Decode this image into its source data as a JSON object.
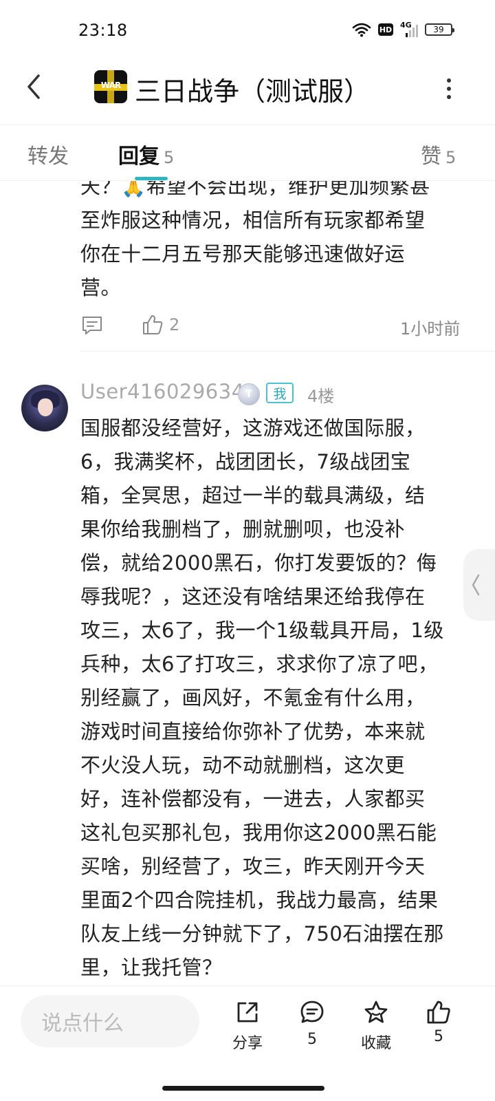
{
  "status_bar": {
    "time": "23:18",
    "hd": "HD",
    "network": "4G",
    "battery": "39"
  },
  "header": {
    "title": "三日战争（测试服）",
    "logo_text": "WAR",
    "back_icon": "chevron-left-icon",
    "more_icon": "more-vertical-icon"
  },
  "tabs": {
    "forward": {
      "label": "转发"
    },
    "reply": {
      "label": "回复",
      "count": "5"
    },
    "like": {
      "label": "赞",
      "count": "5"
    }
  },
  "previous_comment": {
    "lines": [
      "天？🙏希望不会出现，维护更加频繁甚",
      "至炸服这种情况，相信所有玩家都希望",
      "你在十二月五号那天能够迅速做好运",
      "营。"
    ],
    "likes": "2",
    "time": "1小时前"
  },
  "comment": {
    "username": "User416029634",
    "level_badge": "T",
    "me_badge": "我",
    "floor": "4楼",
    "lines": [
      "国服都没经营好，这游戏还做国际服，",
      "6，我满奖杯，战团团长，7级战团宝",
      "箱，全冥思，超过一半的载具满级，结",
      "果你给我删档了，删就删呗，也没补",
      "偿，就给2000黑石，你打发要饭的？侮",
      "辱我呢？，这还没有啥结果还给我停在",
      "攻三，太6了，我一个1级载具开局，1级",
      "兵种，太6了打攻三，求求你了凉了吧，",
      "别经赢了，画风好，不氪金有什么用，",
      "游戏时间直接给你弥补了优势，本来就",
      "不火没人玩，动不动就删档，这次更",
      "好，连补偿都没有，一进去，人家都买",
      "这礼包买那礼包，我用你这2000黑石能",
      "买啥，别经营了，攻三，昨天刚开今天",
      "里面2个四合院挂机，我战力最高，结果",
      "队友上线一分钟就下了，750石油摆在那",
      "里，让我托管？"
    ]
  },
  "bottom_bar": {
    "input_placeholder": "说点什么",
    "share_label": "分享",
    "comment_count": "5",
    "favorite_label": "收藏",
    "like_count": "5"
  },
  "colors": {
    "accent": "#2fb6c4",
    "text": "#222222",
    "muted": "#999999"
  }
}
